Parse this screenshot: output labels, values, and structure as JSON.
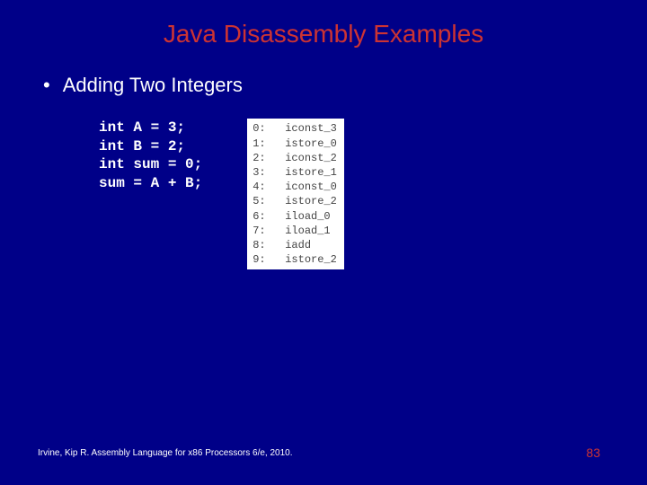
{
  "title": "Java Disassembly Examples",
  "bullet": {
    "symbol": "•",
    "text": "Adding Two Integers"
  },
  "code": {
    "java": "int A = 3;\nint B = 2;\nint sum = 0;\nsum = A + B;",
    "bytecode": "0:   iconst_3\n1:   istore_0\n2:   iconst_2\n3:   istore_1\n4:   iconst_0\n5:   istore_2\n6:   iload_0\n7:   iload_1\n8:   iadd\n9:   istore_2"
  },
  "footer": {
    "citation": "Irvine, Kip R. Assembly Language for x86 Processors 6/e, 2010.",
    "page": "83"
  }
}
